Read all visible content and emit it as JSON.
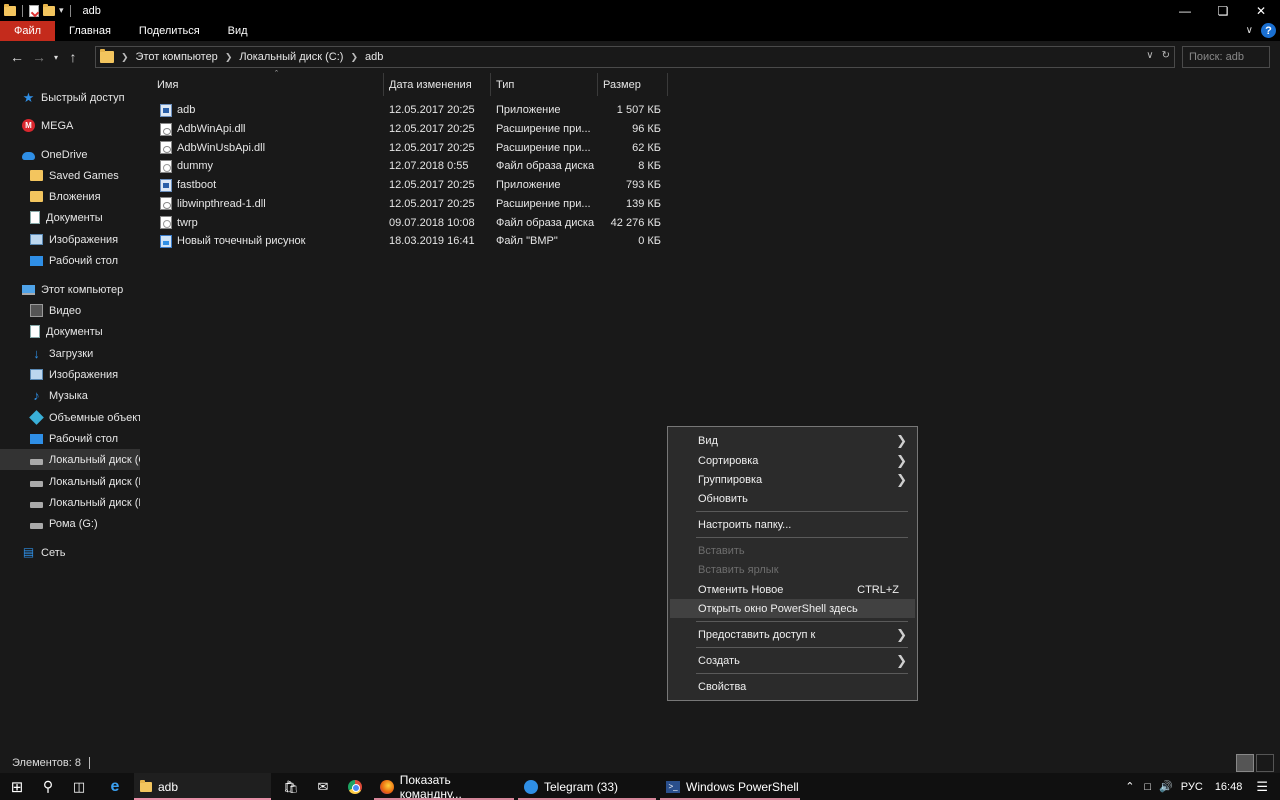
{
  "window": {
    "title": "adb"
  },
  "ribbon": {
    "tabs": [
      "Файл",
      "Главная",
      "Поделиться",
      "Вид"
    ]
  },
  "address": {
    "crumbs": [
      "Этот компьютер",
      "Локальный диск (C:)",
      "adb"
    ],
    "search_placeholder": "Поиск: adb"
  },
  "sidebar": {
    "items": [
      {
        "label": "Быстрый доступ",
        "icon": "star-icon"
      },
      {
        "label": "MEGA",
        "icon": "mega-icon"
      },
      {
        "label": "OneDrive",
        "icon": "cloud-icon"
      },
      {
        "label": "Saved Games",
        "icon": "folder-icon"
      },
      {
        "label": "Вложения",
        "icon": "folder-icon"
      },
      {
        "label": "Документы",
        "icon": "document-icon"
      },
      {
        "label": "Изображения",
        "icon": "image-icon"
      },
      {
        "label": "Рабочий стол",
        "icon": "desktop-icon"
      },
      {
        "label": "Этот компьютер",
        "icon": "computer-icon"
      },
      {
        "label": "Видео",
        "icon": "video-icon"
      },
      {
        "label": "Документы",
        "icon": "document-icon"
      },
      {
        "label": "Загрузки",
        "icon": "download-icon"
      },
      {
        "label": "Изображения",
        "icon": "image-icon"
      },
      {
        "label": "Музыка",
        "icon": "music-icon"
      },
      {
        "label": "Объемные объекты",
        "icon": "3d-objects-icon"
      },
      {
        "label": "Рабочий стол",
        "icon": "desktop-icon"
      },
      {
        "label": "Локальный диск (C:)",
        "icon": "drive-icon"
      },
      {
        "label": "Локальный диск (D:)",
        "icon": "drive-icon"
      },
      {
        "label": "Локальный диск (F:)",
        "icon": "drive-icon"
      },
      {
        "label": "Рома (G:)",
        "icon": "drive-icon"
      },
      {
        "label": "Сеть",
        "icon": "network-icon"
      }
    ]
  },
  "file_list": {
    "columns": [
      "Имя",
      "Дата изменения",
      "Тип",
      "Размер"
    ],
    "rows": [
      {
        "name": "adb",
        "date": "12.05.2017 20:25",
        "type": "Приложение",
        "size": "1 507 КБ",
        "icon": "app"
      },
      {
        "name": "AdbWinApi.dll",
        "date": "12.05.2017 20:25",
        "type": "Расширение при...",
        "size": "96 КБ",
        "icon": "dll"
      },
      {
        "name": "AdbWinUsbApi.dll",
        "date": "12.05.2017 20:25",
        "type": "Расширение при...",
        "size": "62 КБ",
        "icon": "dll"
      },
      {
        "name": "dummy",
        "date": "12.07.2018 0:55",
        "type": "Файл образа диска",
        "size": "8 КБ",
        "icon": "gen"
      },
      {
        "name": "fastboot",
        "date": "12.05.2017 20:25",
        "type": "Приложение",
        "size": "793 КБ",
        "icon": "app"
      },
      {
        "name": "libwinpthread-1.dll",
        "date": "12.05.2017 20:25",
        "type": "Расширение при...",
        "size": "139 КБ",
        "icon": "dll"
      },
      {
        "name": "twrp",
        "date": "09.07.2018 10:08",
        "type": "Файл образа диска",
        "size": "42 276 КБ",
        "icon": "gen"
      },
      {
        "name": "Новый точечный рисунок",
        "date": "18.03.2019 16:41",
        "type": "Файл \"BMP\"",
        "size": "0 КБ",
        "icon": "bmp"
      }
    ]
  },
  "context_menu": {
    "items": [
      {
        "label": "Вид",
        "submenu": true
      },
      {
        "label": "Сортировка",
        "submenu": true
      },
      {
        "label": "Группировка",
        "submenu": true
      },
      {
        "label": "Обновить"
      },
      {
        "label": "Настроить папку..."
      },
      {
        "label": "Вставить",
        "disabled": true
      },
      {
        "label": "Вставить ярлык",
        "disabled": true
      },
      {
        "label": "Отменить Новое",
        "shortcut": "CTRL+Z"
      },
      {
        "label": "Открыть окно PowerShell здесь",
        "highlighted": true
      },
      {
        "label": "Предоставить доступ к",
        "submenu": true
      },
      {
        "label": "Создать",
        "submenu": true
      },
      {
        "label": "Свойства"
      }
    ]
  },
  "status": {
    "items_count": "Элементов: 8"
  },
  "taskbar": {
    "apps": [
      {
        "label": "adb"
      },
      {
        "label": "Показать командну..."
      },
      {
        "label": "Telegram (33)"
      },
      {
        "label": "Windows PowerShell"
      }
    ],
    "tray": {
      "language": "РУС",
      "time": "16:48"
    }
  },
  "colors": {
    "accent": "#c42b1c",
    "background": "#191919",
    "menu": "#2b2b2b"
  }
}
